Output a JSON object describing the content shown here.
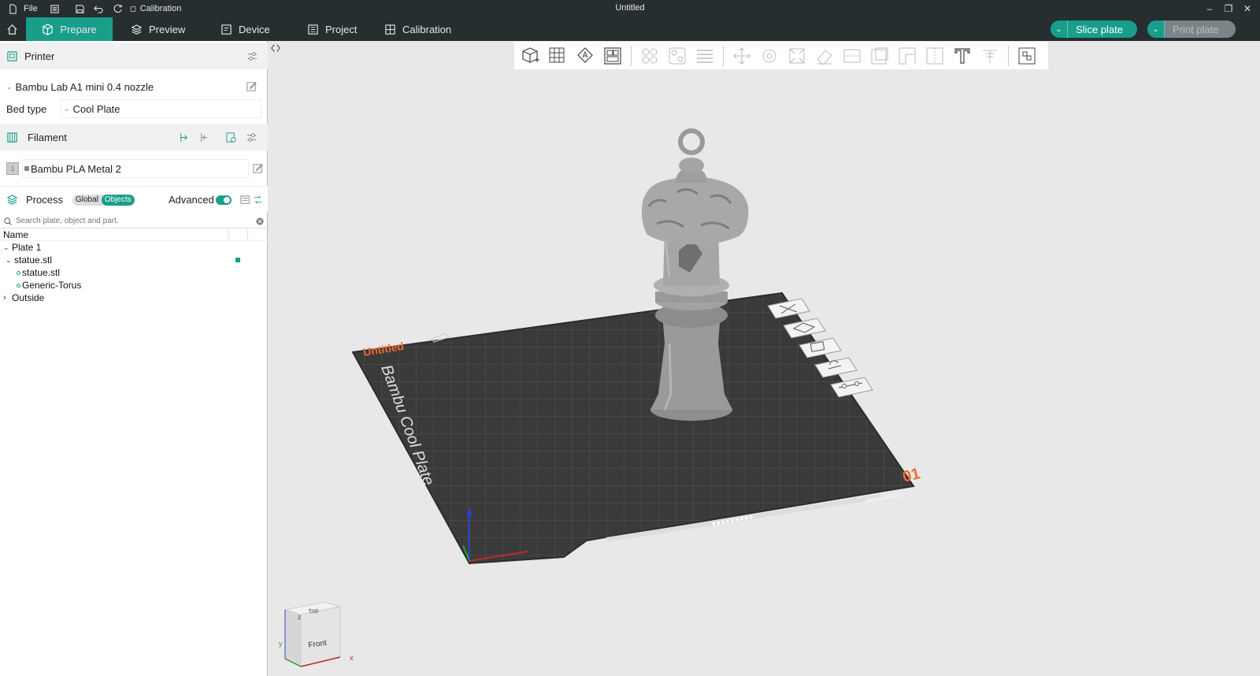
{
  "titlebar": {
    "file_label": "File",
    "calib_label": "Calibration",
    "title": "Untitled"
  },
  "tabs": {
    "prepare": "Prepare",
    "preview": "Preview",
    "device": "Device",
    "project": "Project",
    "calibration": "Calibration"
  },
  "actions": {
    "slice": "Slice plate",
    "print": "Print plate"
  },
  "printer": {
    "section_title": "Printer",
    "printer_name": "Bambu Lab A1 mini 0.4 nozzle",
    "bed_type_label": "Bed type",
    "bed_type_value": "Cool Plate"
  },
  "filament": {
    "section_title": "Filament",
    "slot_number": "1",
    "filament_name": "Bambu PLA Metal 2"
  },
  "process": {
    "section_title": "Process",
    "global_label": "Global",
    "objects_label": "Objects",
    "advanced_label": "Advanced"
  },
  "search": {
    "placeholder": "Search plate, object and part."
  },
  "tree": {
    "header": "Name",
    "plate": "Plate 1",
    "object": "statue.stl",
    "part1": "statue.stl",
    "part2": "Generic-Torus",
    "outside": "Outside"
  },
  "plate": {
    "name": "Untitled",
    "brand_text": "Bambu Cool Plate",
    "number": "01"
  },
  "navcube": {
    "top": "Top",
    "front": "Front",
    "axis_x": "x",
    "axis_y": "y",
    "axis_z": "z"
  },
  "colors": {
    "accent": "#189e8a",
    "titlebar": "#262e30",
    "plate_orange": "#f06a34"
  }
}
